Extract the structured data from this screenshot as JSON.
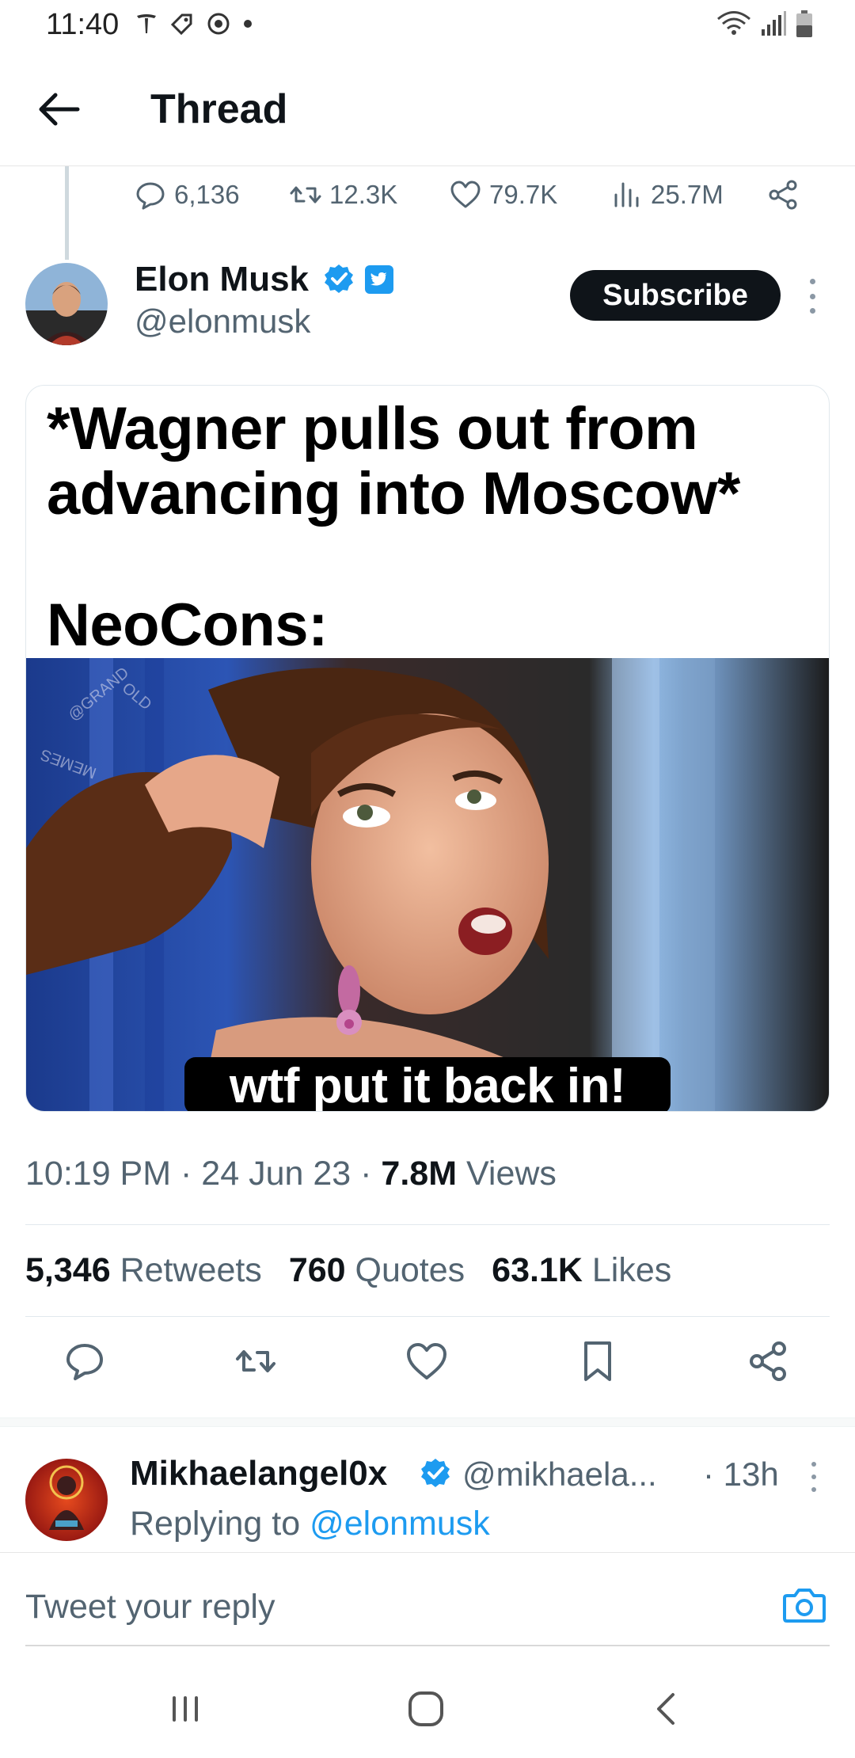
{
  "status_bar": {
    "time": "11:40",
    "left_icons": [
      "tesla-icon",
      "tag-icon",
      "instagram-icon",
      "dot-icon"
    ],
    "right_icons": [
      "wifi-icon",
      "signal-icon",
      "battery-icon"
    ]
  },
  "app_bar": {
    "title": "Thread",
    "back_icon": "back-arrow-icon"
  },
  "prev_tweet_metrics": {
    "replies": "6,136",
    "retweets": "12.3K",
    "likes": "79.7K",
    "views": "25.7M"
  },
  "tweet": {
    "author_name": "Elon Musk",
    "author_handle": "@elonmusk",
    "subscribe_label": "Subscribe",
    "meme": {
      "line1": "*Wagner pulls out from",
      "line2": "advancing into Moscow*",
      "line3": "NeoCons:",
      "watermark": "@GRANDOLDMEMES",
      "caption": "wtf put it back in!"
    },
    "time": "10:19 PM",
    "date": "24 Jun 23",
    "views_count": "7.8M",
    "views_label": "Views",
    "stats": {
      "retweets_count": "5,346",
      "retweets_label": "Retweets",
      "quotes_count": "760",
      "quotes_label": "Quotes",
      "likes_count": "63.1K",
      "likes_label": "Likes"
    }
  },
  "reply": {
    "author_name": "Mikhaelangel0x",
    "author_handle": "@mikhaela...",
    "time": "· 13h",
    "replying_prefix": "Replying to",
    "replying_handle": "@elonmusk"
  },
  "composer": {
    "placeholder": "Tweet your reply"
  },
  "colors": {
    "accent": "#1d9bf0",
    "text_primary": "#0f1419",
    "text_secondary": "#536471"
  }
}
